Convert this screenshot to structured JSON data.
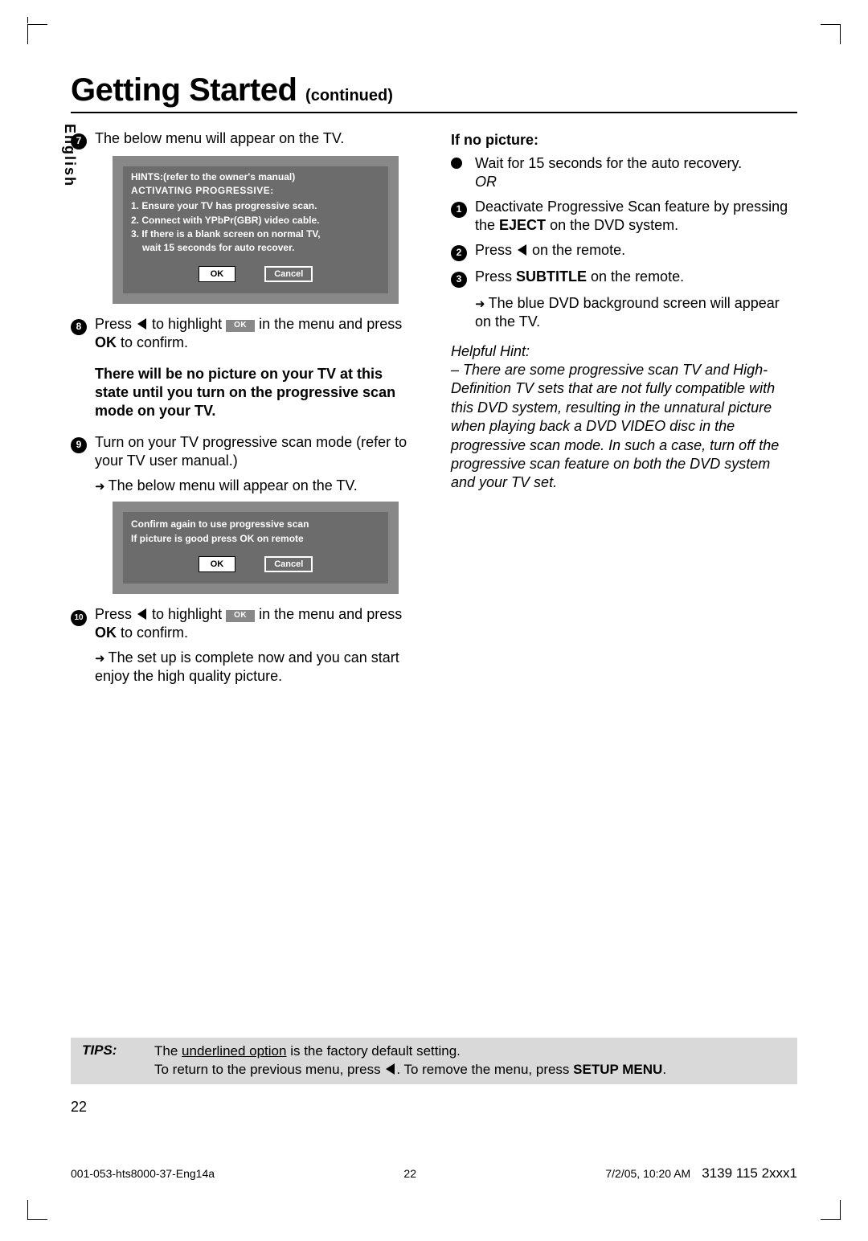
{
  "lang_tab": "English",
  "title_main": "Getting Started",
  "title_sub": "(continued)",
  "col1": {
    "s7": "The below menu will appear on the TV.",
    "tv1": {
      "hints": "HINTS:(refer to the owner's manual)",
      "act": "ACTIVATING PROGRESSIVE:",
      "l1": "1. Ensure your TV has progressive scan.",
      "l2": "2. Connect with YPbPr(GBR) video cable.",
      "l3": "3. If there is a blank screen on normal TV,",
      "l4": "wait 15 seconds for auto recover.",
      "ok": "OK",
      "cancel": "Cancel"
    },
    "s8a": "Press ",
    "s8b": " to highlight ",
    "s8c": " in the menu and press ",
    "s8ok": "OK",
    "s8d": " to confirm.",
    "inlineok": "OK",
    "warn": "There will be no picture on your TV at this state until you turn on the progressive scan mode on your TV.",
    "s9a": "Turn on your TV progressive scan mode (refer to your TV user manual.)",
    "s9b": "The below menu will appear on the TV.",
    "tv2": {
      "l1": "Confirm again to use progressive scan",
      "l2": "If picture is good press OK on remote",
      "ok": "OK",
      "cancel": "Cancel"
    },
    "s10a": "Press ",
    "s10b": " to highlight ",
    "s10c": " in the menu and press ",
    "s10ok": "OK",
    "s10d": " to confirm.",
    "s10e": "The set up is complete now and you can start enjoy the high quality picture."
  },
  "col2": {
    "head": "If no picture:",
    "bullet1": "Wait for 15 seconds for the auto recovery.",
    "or": "OR",
    "s1a": "Deactivate Progressive Scan feature by pressing the ",
    "eject": "EJECT",
    "s1b": " on the DVD system.",
    "s2a": "Press ",
    "s2b": " on the remote.",
    "s3a": "Press ",
    "subtitle": "SUBTITLE",
    "s3b": " on the remote.",
    "s3c": "The blue DVD background screen will appear on the TV.",
    "hinthead": "Helpful Hint:",
    "hintbody": "– There are some progressive scan TV and High-Definition TV sets that are not fully compatible with this DVD system, resulting in the unnatural picture when playing back a DVD VIDEO disc in the progressive scan mode.  In such a case, turn off the progressive scan feature on both the DVD system and your TV set."
  },
  "tips": {
    "label": "TIPS:",
    "line1a": "The ",
    "line1u": "underlined option",
    "line1b": " is the factory default setting.",
    "line2a": "To return to the previous menu, press ",
    "line2b": ".  To remove the menu, press ",
    "setup": "SETUP MENU",
    "line2c": "."
  },
  "page_num": "22",
  "footer": {
    "file": "001-053-hts8000-37-Eng14a",
    "mid": "22",
    "date": "7/2/05, 10:20 AM",
    "partno": "3139 115 2xxx1"
  }
}
